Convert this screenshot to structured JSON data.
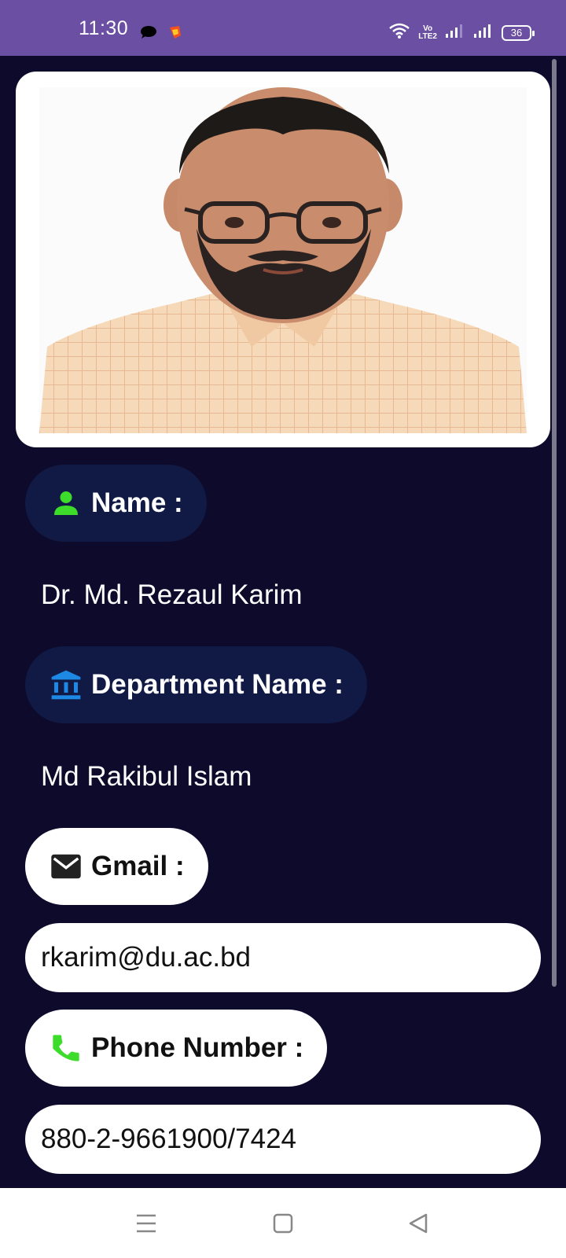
{
  "status_bar": {
    "time": "11:30",
    "battery": "36",
    "volte_top": "Vo",
    "volte_bottom": "LTE2",
    "background": "#6a4fa3"
  },
  "profile": {
    "name_label": "Name :",
    "name_value": "Dr. Md. Rezaul Karim",
    "department_label": "Department Name :",
    "department_value": "Md Rakibul Islam",
    "gmail_label": "Gmail :",
    "gmail_value": "rkarim@du.ac.bd",
    "phone_label": "Phone Number :",
    "phone_value": "880-2-9661900/7424"
  },
  "icons": {
    "name": "person-icon",
    "department": "institution-icon",
    "gmail": "mail-icon",
    "phone": "phone-icon"
  },
  "colors": {
    "background": "#0e0a2b",
    "dark_pill": "#101a44",
    "person_icon": "#3ddc2b",
    "institution_icon": "#1e88e5",
    "phone_icon": "#3ddc2b"
  }
}
